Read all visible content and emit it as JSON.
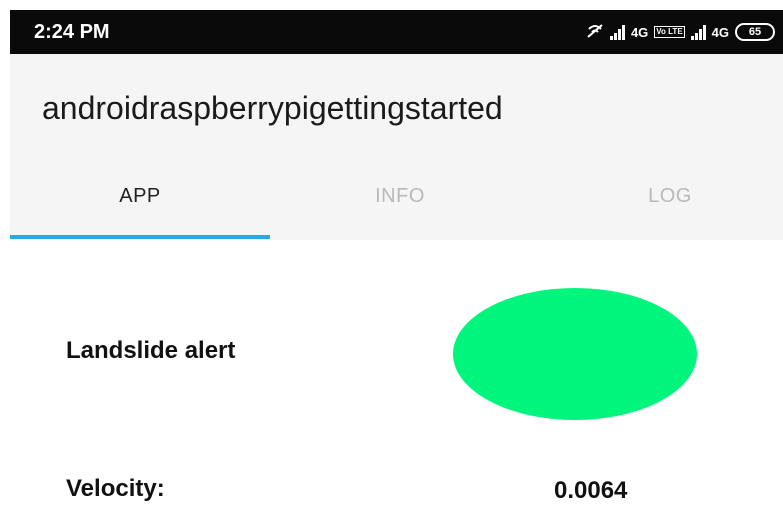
{
  "status_bar": {
    "time": "2:24 PM",
    "network_label_1": "4G",
    "network_label_2": "4G",
    "volte_label": "Vo LTE",
    "battery_level": "65",
    "icons": [
      "signal-off-icon",
      "signal-icon",
      "signal-icon",
      "battery-icon"
    ]
  },
  "app_bar": {
    "title": "androidraspberrypigettingstarted"
  },
  "tabs": [
    {
      "label": "APP",
      "active": true
    },
    {
      "label": "INFO",
      "active": false
    },
    {
      "label": "LOG",
      "active": false
    }
  ],
  "main": {
    "alert_label": "Landslide alert",
    "alert_status_color": "#00f57d",
    "velocity_label": "Velocity:",
    "velocity_value": "0.0064"
  },
  "colors": {
    "tab_indicator": "#2aa8df",
    "status_bar_bg": "#0a0a0a",
    "app_bar_bg": "#f5f5f5"
  }
}
